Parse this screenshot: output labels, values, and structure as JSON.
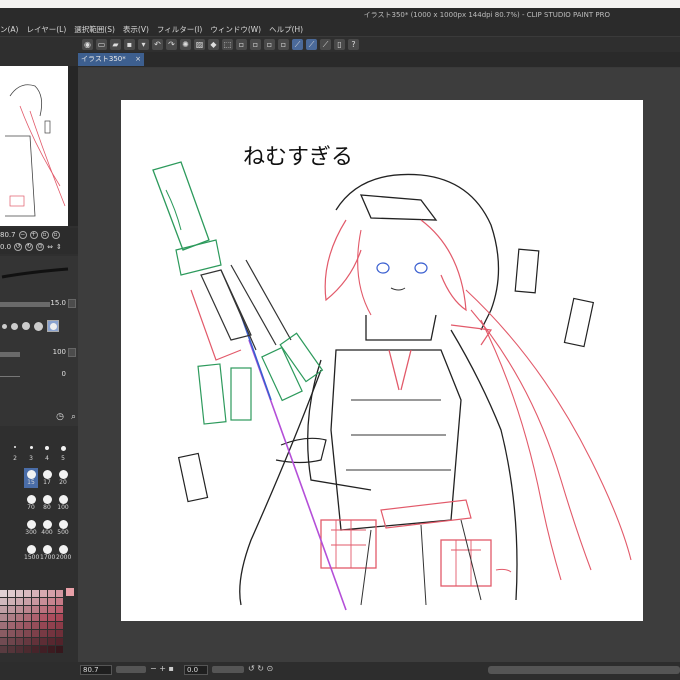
{
  "window": {
    "title": "イラスト350* (1000 x 1000px 144dpi 80.7%) - CLIP STUDIO PAINT PRO"
  },
  "menu": [
    {
      "label": "ン(A)"
    },
    {
      "label": "レイヤー(L)"
    },
    {
      "label": "選択範囲(S)"
    },
    {
      "label": "表示(V)"
    },
    {
      "label": "フィルター(I)"
    },
    {
      "label": "ウィンドウ(W)"
    },
    {
      "label": "ヘルプ(H)"
    }
  ],
  "tab": {
    "label": "イラスト350*",
    "close": "×"
  },
  "canvas": {
    "handwritten_text": "ねむすぎる"
  },
  "navigator": {
    "zoom_value": "80.7",
    "rotate_value": "0.0"
  },
  "properties": {
    "brush_size": "15.0",
    "opacity": "100",
    "third_value": "0"
  },
  "brush_sizes": {
    "row0": [
      "2",
      "3",
      "4",
      "5"
    ],
    "row1": [
      "15",
      "17",
      "20"
    ],
    "row2": [
      "70",
      "80",
      "100"
    ],
    "row3": [
      "300",
      "400",
      "500"
    ],
    "row4": [
      "1500",
      "1700",
      "2000"
    ]
  },
  "statusbar": {
    "zoom": "80.7",
    "rotation": "0.0"
  },
  "colors": {
    "accent": "#3d5f8f",
    "panel": "#2f2f2f",
    "canvas_bg": "#3d3d3d",
    "line_red": "#e25a6a",
    "line_green": "#2d9a5c",
    "line_blue": "#3a5fd0",
    "line_purple": "#b44fd8"
  }
}
